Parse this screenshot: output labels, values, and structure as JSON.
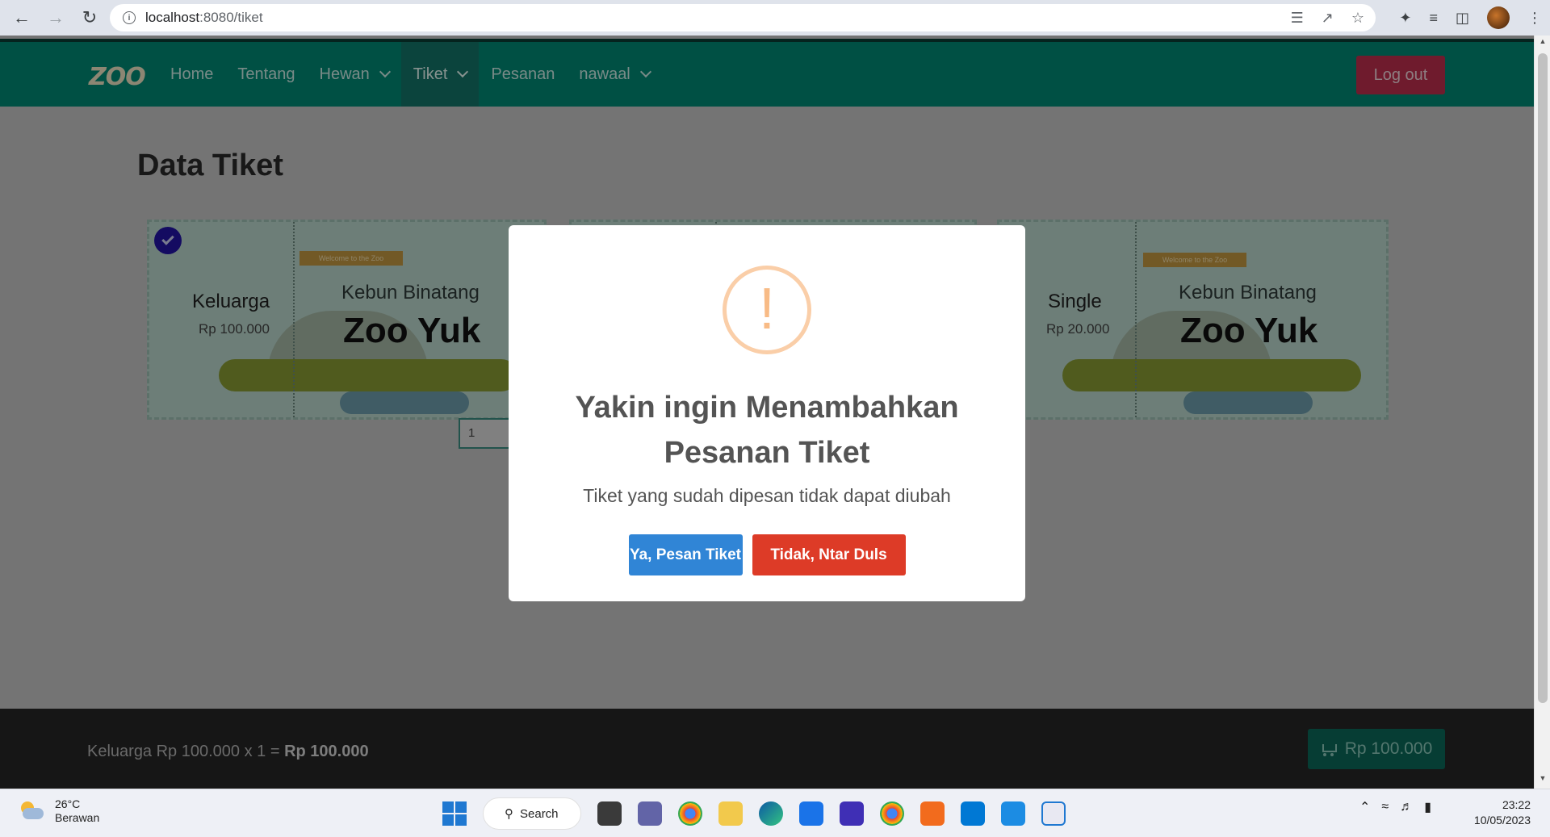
{
  "browser": {
    "url_host": "localhost",
    "url_path": ":8080/tiket"
  },
  "nav": {
    "logo": "ZOO",
    "links": [
      {
        "label": "Home"
      },
      {
        "label": "Tentang"
      },
      {
        "label": "Hewan"
      },
      {
        "label": "Tiket"
      },
      {
        "label": "Pesanan"
      },
      {
        "label": "nawaal"
      }
    ],
    "logout_label": "Log out"
  },
  "page": {
    "title": "Data Tiket"
  },
  "tickets": [
    {
      "type": "Keluarga",
      "price": "Rp 100.000",
      "banner": "Welcome to the Zoo",
      "brand_sub": "Kebun Binatang",
      "brand": "Zoo Yuk",
      "selected": true,
      "quantity": "1"
    },
    {
      "type": "Single",
      "price": "Rp 20.000",
      "banner": "Welcome to the Zoo",
      "brand_sub": "Kebun Binatang",
      "brand": "Zoo Yuk",
      "selected": false
    }
  ],
  "modal": {
    "title": "Yakin ingin Menambahkan Pesanan Tiket",
    "text": "Tiket yang sudah dipesan tidak dapat diubah",
    "confirm_label": "Ya, Pesan Tiket",
    "cancel_label": "Tidak, Ntar Duls",
    "icon": "!"
  },
  "footer": {
    "summary_prefix": "Keluarga Rp 100.000 x 1 = ",
    "summary_total": "Rp 100.000",
    "cart_total": "Rp 100.000"
  },
  "taskbar": {
    "weather_temp": "26°C",
    "weather_desc": "Berawan",
    "search_label": "Search",
    "time": "23:22",
    "date": "10/05/2023"
  },
  "colors": {
    "navbar": "#008a75",
    "logout": "#c0304f",
    "confirm": "#3085d6",
    "cancel": "#dd3b27",
    "warning_icon": "#f8bb86"
  }
}
